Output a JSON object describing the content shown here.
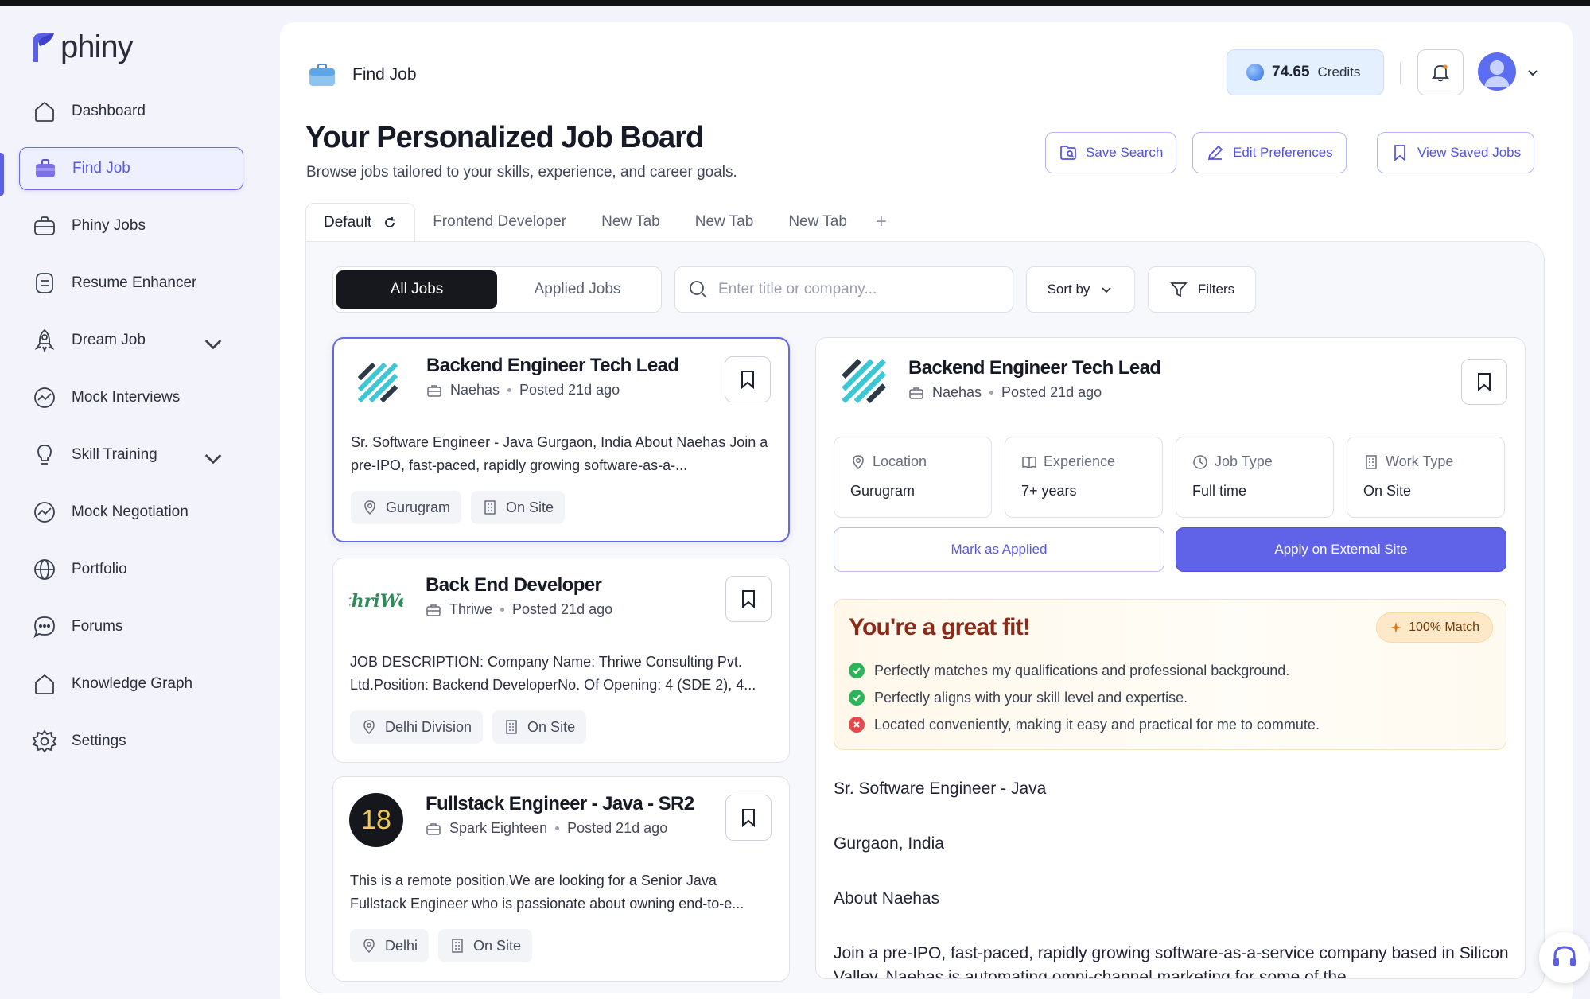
{
  "app": {
    "name": "phiny",
    "colors": {
      "accent": "#5b5ee6",
      "apply": "#6062e8",
      "fit_title": "#8a2a17"
    }
  },
  "sidebar": {
    "items": [
      {
        "label": "Dashboard",
        "icon": "home-icon"
      },
      {
        "label": "Find Job",
        "icon": "briefcase-icon",
        "active": true
      },
      {
        "label": "Phiny Jobs",
        "icon": "briefcase-icon"
      },
      {
        "label": "Resume Enhancer",
        "icon": "document-icon"
      },
      {
        "label": "Dream Job",
        "icon": "rocket-icon",
        "expandable": true
      },
      {
        "label": "Mock Interviews",
        "icon": "chart-bubble-icon"
      },
      {
        "label": "Skill Training",
        "icon": "lightbulb-icon",
        "expandable": true
      },
      {
        "label": "Mock Negotiation",
        "icon": "chart-bubble-icon"
      },
      {
        "label": "Portfolio",
        "icon": "globe-icon"
      },
      {
        "label": "Forums",
        "icon": "chat-icon"
      },
      {
        "label": "Knowledge Graph",
        "icon": "home-icon"
      },
      {
        "label": "Settings",
        "icon": "gear-icon"
      }
    ]
  },
  "header": {
    "title": "Find Job",
    "credits_value": "74.65",
    "credits_label": "Credits"
  },
  "page": {
    "title": "Your Personalized Job Board",
    "subtitle": "Browse jobs tailored to your skills, experience, and career goals.",
    "actions": {
      "save_search": "Save Search",
      "edit_preferences": "Edit Preferences",
      "view_saved": "View Saved Jobs"
    }
  },
  "tabs": [
    "Default",
    "Frontend Developer",
    "New Tab",
    "New Tab",
    "New Tab"
  ],
  "toolbar": {
    "all_jobs": "All Jobs",
    "applied_jobs": "Applied Jobs",
    "search_placeholder": "Enter title or company...",
    "sort_label": "Sort by",
    "filters_label": "Filters"
  },
  "jobs": [
    {
      "title": "Backend Engineer Tech Lead",
      "company": "Naehas",
      "posted": "Posted 21d ago",
      "description": "Sr. Software Engineer - Java Gurgaon, India About Naehas Join a pre-IPO, fast-paced, rapidly growing software-as-a-...",
      "location": "Gurugram",
      "work_type": "On Site"
    },
    {
      "title": "Back End Developer",
      "company": "Thriwe",
      "logo_text": "thriWe",
      "posted": "Posted 21d ago",
      "description": "JOB DESCRIPTION: Company Name: Thriwe Consulting Pvt. Ltd.Position: Backend DeveloperNo. Of Opening: 4 (SDE 2), 4...",
      "location": "Delhi Division",
      "work_type": "On Site"
    },
    {
      "title": "Fullstack Engineer - Java - SR2",
      "company": "Spark Eighteen",
      "logo_text": "18",
      "posted": "Posted 21d ago",
      "description": "This is a remote position.We are looking for a Senior Java Fullstack Engineer who is passionate about owning end-to-e...",
      "location": "Delhi",
      "work_type": "On Site"
    }
  ],
  "detail": {
    "title": "Backend Engineer Tech Lead",
    "company": "Naehas",
    "posted": "Posted 21d ago",
    "info": [
      {
        "label": "Location",
        "value": "Gurugram",
        "icon": "pin-icon"
      },
      {
        "label": "Experience",
        "value": "7+ years",
        "icon": "book-icon"
      },
      {
        "label": "Job Type",
        "value": "Full time",
        "icon": "clock-icon"
      },
      {
        "label": "Work Type",
        "value": "On Site",
        "icon": "building-icon"
      }
    ],
    "mark_applied": "Mark as Applied",
    "apply_external": "Apply on External Site",
    "fit": {
      "title": "You're a great fit!",
      "match": "100% Match",
      "points": [
        {
          "text": "Perfectly matches my qualifications and professional background.",
          "status": "ok"
        },
        {
          "text": "Perfectly aligns with your skill level and expertise.",
          "status": "ok"
        },
        {
          "text": "Located conveniently, making it easy and practical for me to commute.",
          "status": "no"
        }
      ]
    },
    "body": [
      "Sr. Software Engineer - Java",
      "Gurgaon, India",
      "About Naehas",
      "Join a pre-IPO, fast-paced, rapidly growing software-as-a-service company based in Silicon Valley. Naehas is automating omni-channel marketing for some of the"
    ]
  }
}
